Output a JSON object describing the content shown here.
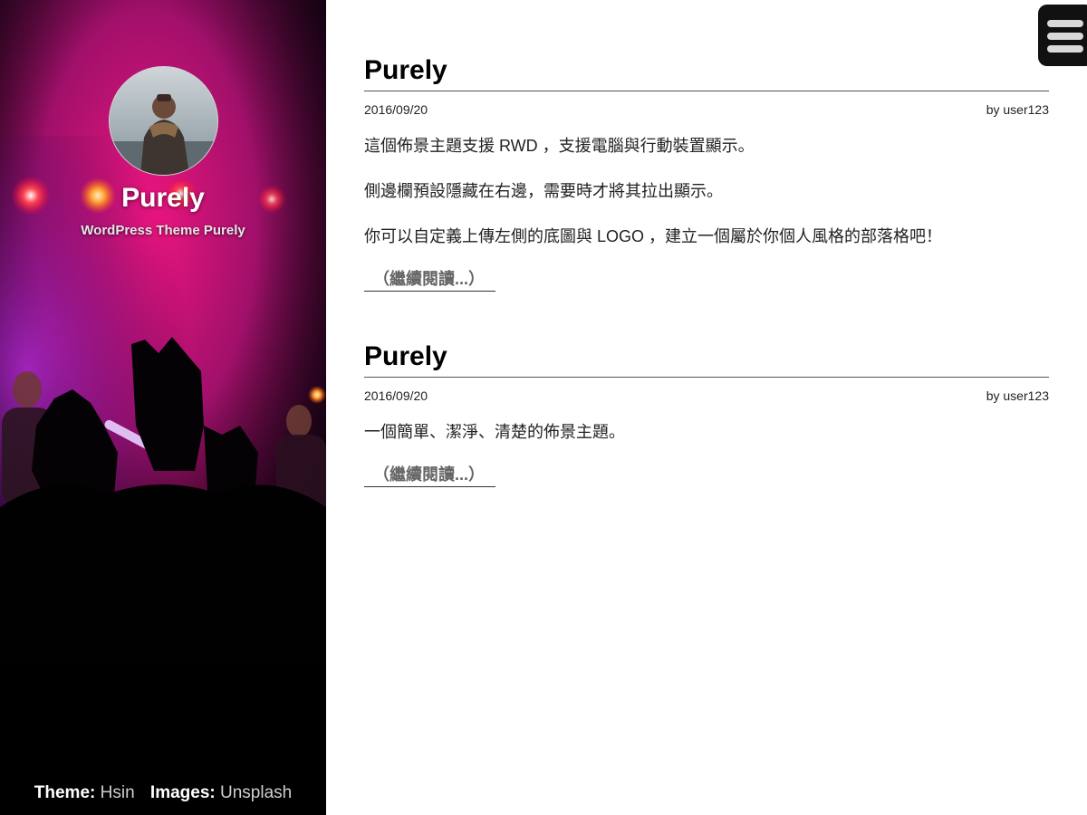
{
  "site": {
    "title": "Purely",
    "description": "WordPress Theme Purely"
  },
  "footer": {
    "theme_label": "Theme:",
    "theme_link": "Hsin",
    "images_label": "Images:",
    "images_link": "Unsplash"
  },
  "posts": [
    {
      "title": "Purely",
      "date": "2016/09/20",
      "author": "by user123",
      "paragraphs": [
        "這個佈景主題支援 RWD ，支援電腦與行動裝置顯示。",
        "側邊欄預設隱藏在右邊，需要時才將其拉出顯示。",
        "你可以自定義上傳左側的底圖與 LOGO ，建立一個屬於你個人風格的部落格吧！"
      ],
      "more": "（繼續閱讀...）"
    },
    {
      "title": "Purely",
      "date": "2016/09/20",
      "author": "by user123",
      "paragraphs": [
        "一個簡單、潔淨、清楚的佈景主題。"
      ],
      "more": "（繼續閱讀...）"
    }
  ],
  "menu": {
    "icon": "hamburger-menu-icon"
  },
  "colors": {
    "sidebar_bg": "#000000",
    "stage_pink": "#e0127a",
    "stage_purple": "#8a1fb8",
    "light_red": "#ff3344",
    "menu_bg": "#111111",
    "menu_bars": "#d9d9d9"
  }
}
